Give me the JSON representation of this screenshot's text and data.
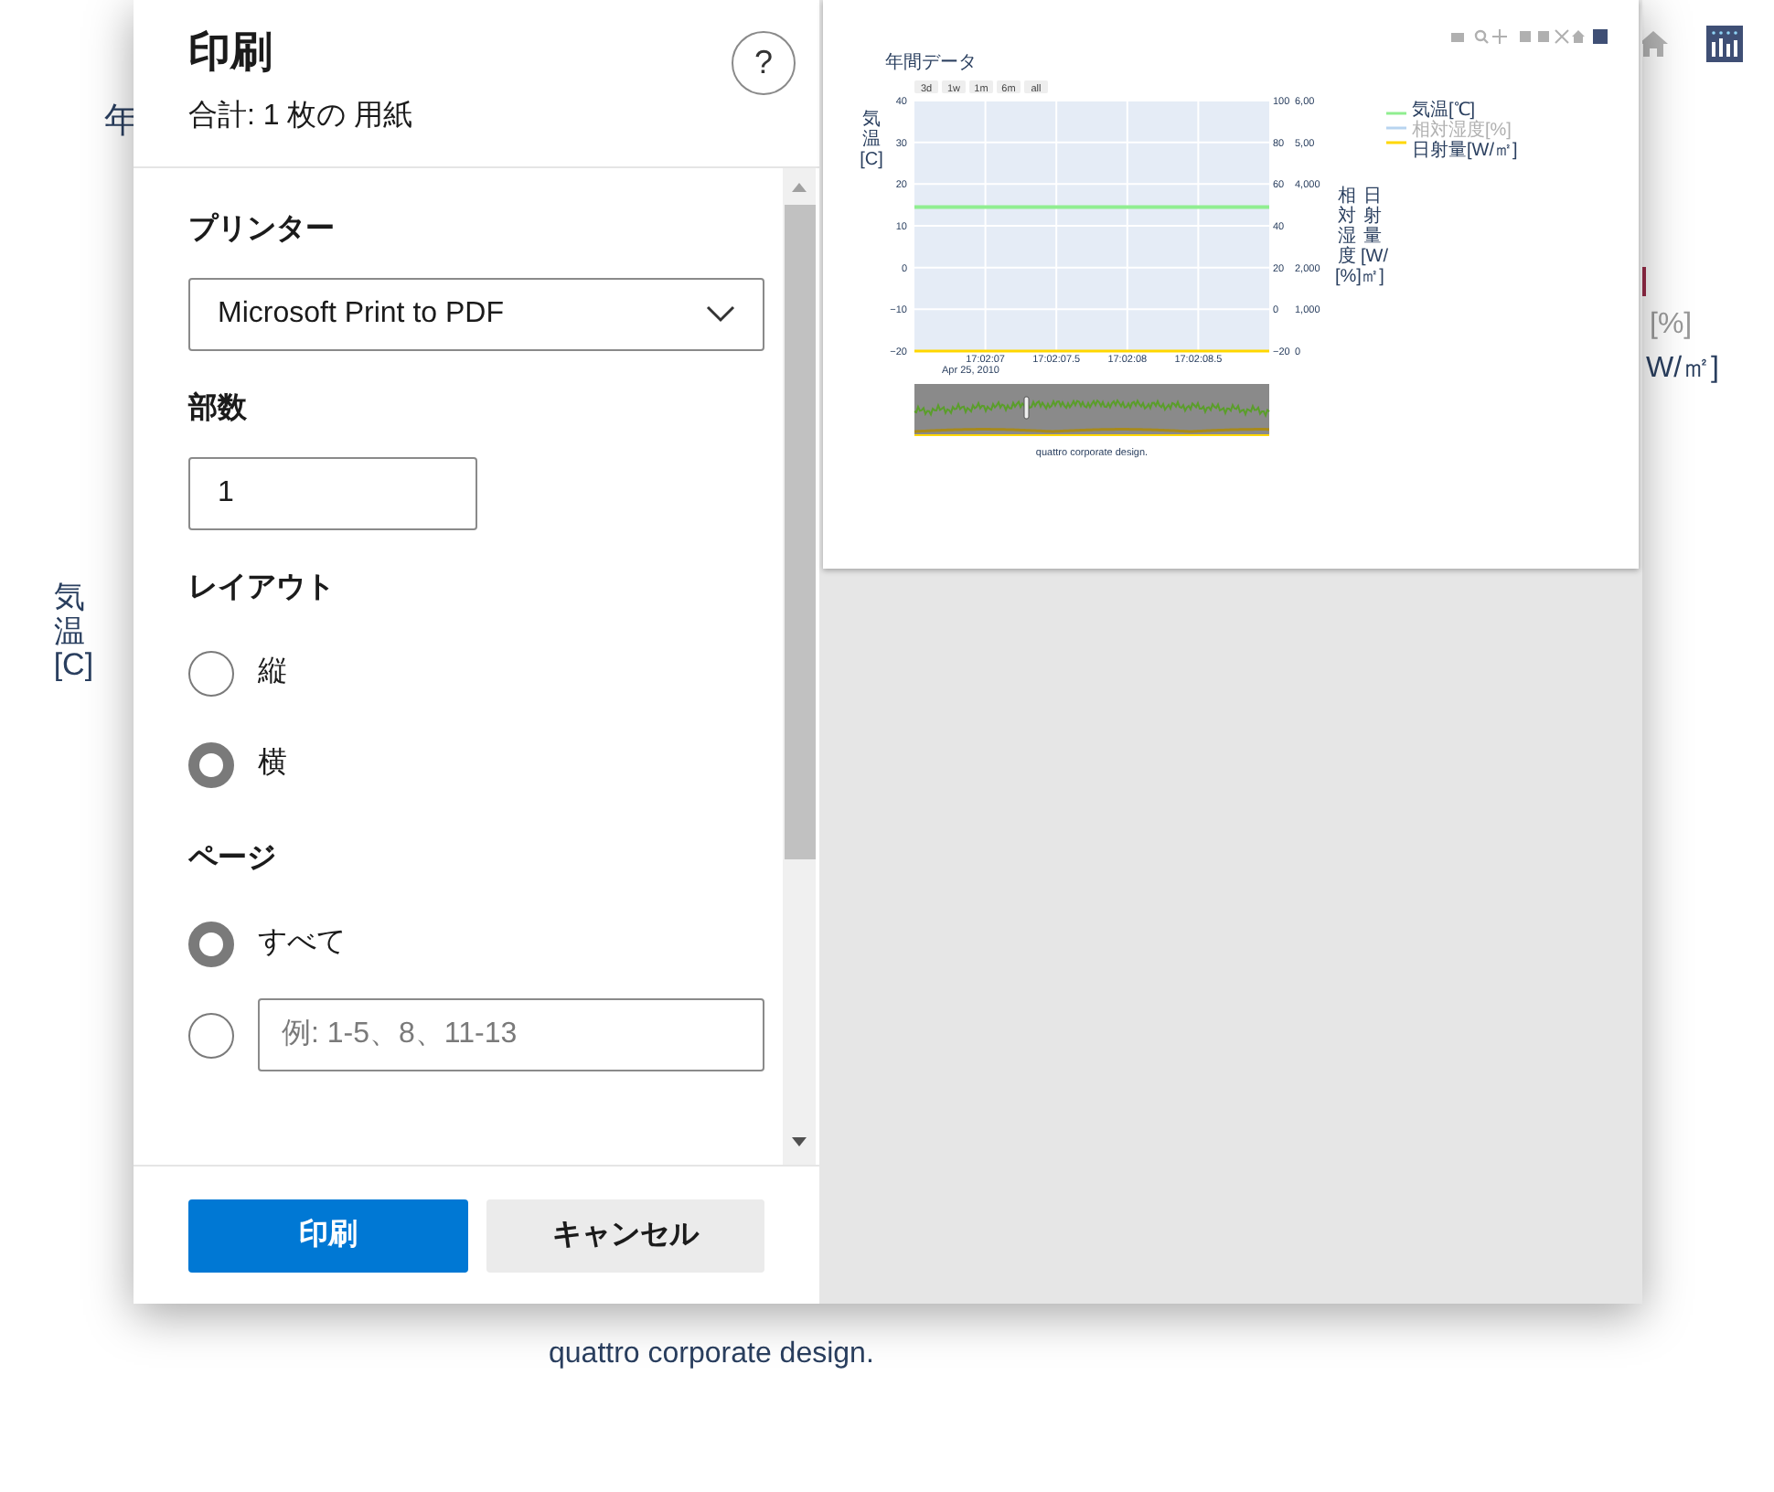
{
  "background": {
    "title_fragment": "年",
    "axis_title": "気温[C]",
    "legend_fragments": [
      "[%]",
      "W/㎡]"
    ],
    "footer": "quattro corporate design."
  },
  "dialog": {
    "title": "印刷",
    "subtitle": "合計: 1 枚の 用紙",
    "help": "?",
    "sections": [
      {
        "kind": "select",
        "label": "プリンター",
        "value": "Microsoft Print to PDF"
      },
      {
        "kind": "input",
        "label": "部数",
        "value": "1"
      },
      {
        "kind": "radios",
        "label": "レイアウト",
        "options": [
          {
            "label": "縦",
            "selected": false
          },
          {
            "label": "横",
            "selected": true
          }
        ]
      },
      {
        "kind": "radios",
        "label": "ページ",
        "options": [
          {
            "label": "すべて",
            "selected": true
          },
          {
            "placeholder": "例: 1-5、8、11-13",
            "selected": false
          }
        ]
      }
    ],
    "buttons": [
      {
        "label": "印刷",
        "primary": true
      },
      {
        "label": "キャンセル",
        "primary": false
      }
    ]
  },
  "preview": {
    "title": "年間データ",
    "range_buttons": [
      "3d",
      "1w",
      "1m",
      "6m",
      "all"
    ],
    "right_axis_ticks": [
      "100",
      "80",
      "60",
      "40",
      "20",
      "0",
      "−20"
    ],
    "far_axis_ticks": [
      "6,00",
      "5,00",
      "4,000",
      "2,000",
      "1,000",
      "0"
    ],
    "axis_titles": [
      "気温[C]",
      "相対湿度[%]",
      "日射量[W/㎡]"
    ],
    "date_label": "Apr 25, 2010",
    "legend_states": [
      {
        "dimmed": false
      },
      {
        "dimmed": true
      },
      {
        "dimmed": false
      }
    ],
    "chart_data": {
      "type": "line",
      "categories": [
        null,
        "17:02:07",
        "17:02:07.5",
        "17:02:08",
        "17:02:08.5",
        null
      ],
      "ylim": [
        -20,
        40
      ],
      "grid": true,
      "yticks": [
        {
          "value": 40,
          "label": "40"
        },
        {
          "value": 30,
          "label": "30"
        },
        {
          "value": 20,
          "label": "20"
        },
        {
          "value": 10,
          "label": "10"
        },
        {
          "value": 0,
          "label": "0"
        },
        {
          "value": -10,
          "label": "−10"
        },
        {
          "value": -20,
          "label": "−20"
        }
      ],
      "series": [
        {
          "name": "気温[℃]",
          "color": "#90ee90",
          "values": [
            14.5,
            14.5,
            14.5,
            14.5,
            14.5,
            14.5
          ]
        },
        {
          "name": "相対湿度[%]",
          "color": "#b8d4f0",
          "values": [
            null,
            null,
            null,
            null,
            null,
            null
          ]
        },
        {
          "name": "日射量[W/㎡]",
          "color": "#ffd700",
          "values": [
            -20,
            -20,
            -20,
            -20,
            -20,
            -20
          ]
        }
      ]
    },
    "footer": "quattro corporate design."
  }
}
